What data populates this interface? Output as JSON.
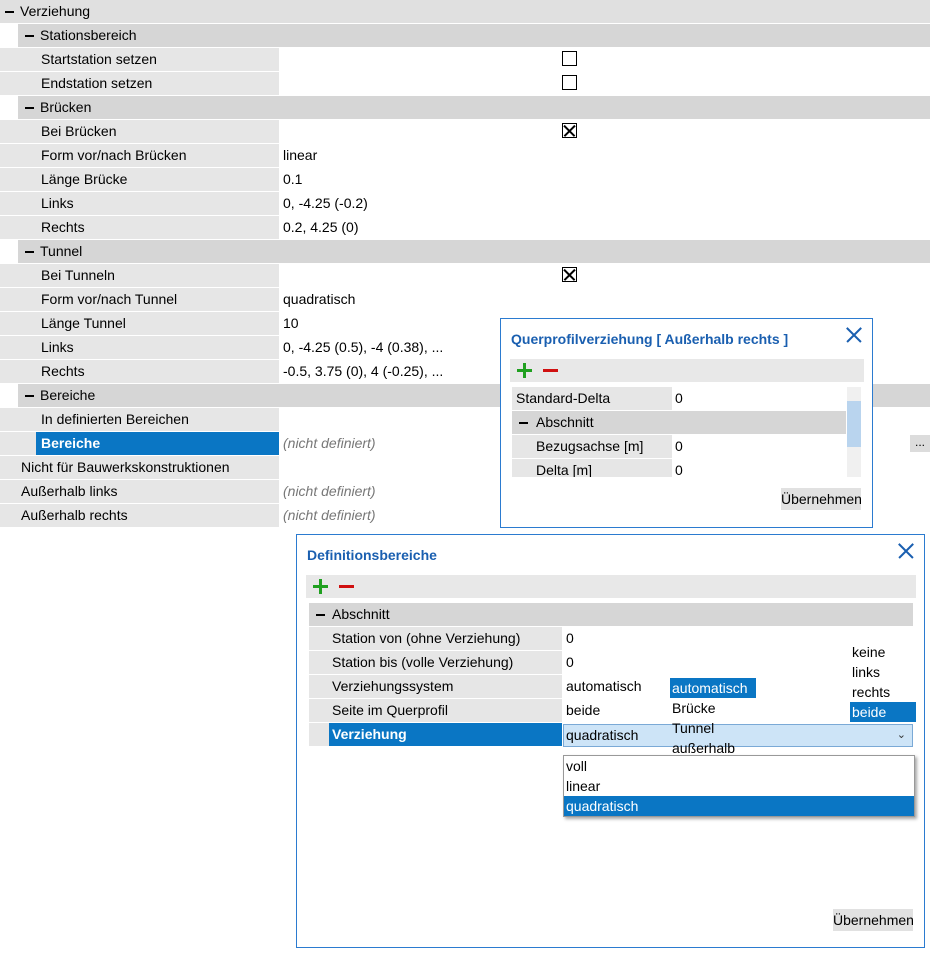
{
  "grid": {
    "root": "Verziehung",
    "stationsbereich": {
      "label": "Stationsbereich",
      "startstation": "Startstation setzen",
      "endstation": "Endstation setzen"
    },
    "bruecken": {
      "label": "Brücken",
      "bei": "Bei Brücken",
      "form": "Form vor/nach Brücken",
      "form_value": "linear",
      "laenge": "Länge Brücke",
      "laenge_value": "0.1",
      "links": "Links",
      "links_value": "0, -4.25 (-0.2)",
      "rechts": "Rechts",
      "rechts_value": "0.2, 4.25 (0)"
    },
    "tunnel": {
      "label": "Tunnel",
      "bei": "Bei Tunneln",
      "form": "Form vor/nach Tunnel",
      "form_value": "quadratisch",
      "laenge": "Länge Tunnel",
      "laenge_value": "10",
      "links": "Links",
      "links_value": "0, -4.25 (0.5), -4 (0.38), ...",
      "rechts": "Rechts",
      "rechts_value": "-0.5, 3.75 (0), 4 (-0.25), ..."
    },
    "bereiche": {
      "label": "Bereiche",
      "in_definierten": "In definierten Bereichen",
      "bereiche": "Bereiche",
      "bereiche_value": "(nicht definiert)",
      "ellipsis": "..."
    },
    "nicht_bauwerk": "Nicht für Bauwerkskonstruktionen",
    "ausserhalb_links": "Außerhalb links",
    "ausserhalb_links_value": "(nicht definiert)",
    "ausserhalb_rechts": "Außerhalb rechts",
    "ausserhalb_rechts_value": "(nicht definiert)"
  },
  "qdialog": {
    "title": "Querprofilverziehung [ Außerhalb rechts ]",
    "standard_delta": "Standard-Delta",
    "standard_delta_value": "0",
    "abschnitt": "Abschnitt",
    "bezugsachse": "Bezugsachse [m]",
    "bezugsachse_value": "0",
    "delta": "Delta [m]",
    "delta_value": "0",
    "apply": "Übernehmen"
  },
  "ddialog": {
    "title": "Definitionsbereiche",
    "abschnitt": "Abschnitt",
    "station_von": "Station von (ohne Verziehung)",
    "station_von_value": "0",
    "station_bis": "Station bis (volle Verziehung)",
    "station_bis_value": "0",
    "system": "Verziehungssystem",
    "system_value": "automatisch",
    "seite": "Seite im Querprofil",
    "seite_value": "beide",
    "verziehung": "Verziehung",
    "verziehung_value": "quadratisch",
    "system_options": [
      "automatisch",
      "Brücke",
      "Tunnel",
      "außerhalb"
    ],
    "seite_options": [
      "keine",
      "links",
      "rechts",
      "beide"
    ],
    "verziehung_options": [
      "voll",
      "linear",
      "quadratisch"
    ],
    "apply": "Übernehmen"
  }
}
